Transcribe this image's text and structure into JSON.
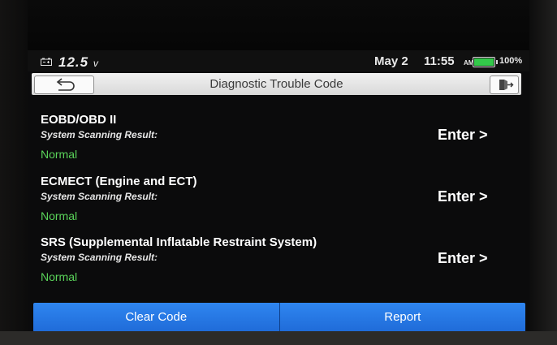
{
  "status_bar": {
    "battery_icon": "car-battery-icon",
    "voltage": "12.5",
    "voltage_unit": "v",
    "date": "May 2",
    "time": "11:55",
    "ampm": "AM",
    "battery_percent": "100%",
    "battery_level": 1.0,
    "battery_color": "#33c94a"
  },
  "header": {
    "title": "Diagnostic Trouble Code",
    "back_icon": "back-arrow-icon",
    "exit_icon": "exit-icon"
  },
  "systems": [
    {
      "name": "EOBD/OBD II",
      "subtitle": "System Scanning Result:",
      "status": "Normal",
      "action": "Enter >"
    },
    {
      "name": "ECMECT (Engine and ECT)",
      "subtitle": "System Scanning Result:",
      "status": "Normal",
      "action": "Enter >"
    },
    {
      "name": "SRS (Supplemental Inflatable Restraint System)",
      "subtitle": "System Scanning Result:",
      "status": "Normal",
      "action": "Enter >"
    }
  ],
  "footer": {
    "clear_code_label": "Clear Code",
    "report_label": "Report",
    "button_color": "#2a7de8"
  }
}
